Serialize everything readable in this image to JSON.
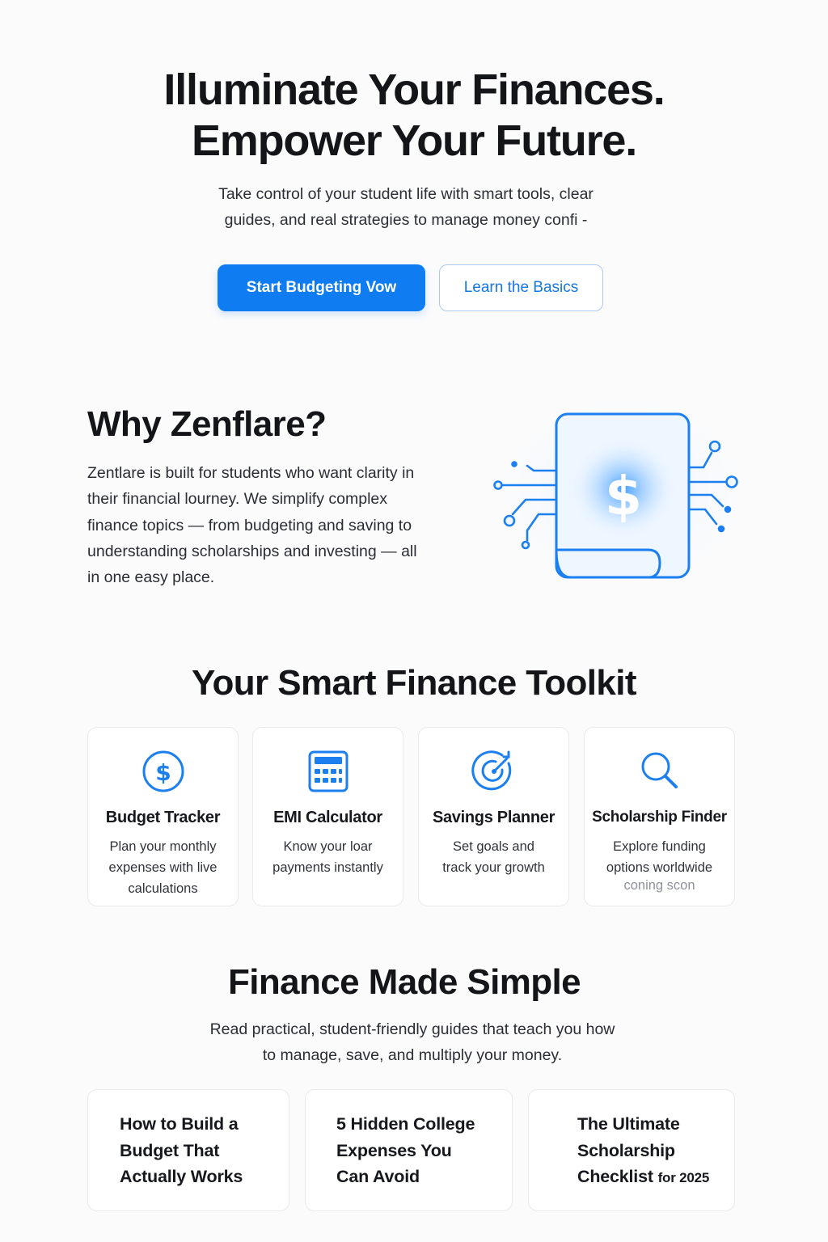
{
  "hero": {
    "title_line1": "Illuminate Your Finances.",
    "title_line2": "Empower Your Future.",
    "subtitle_line1": "Take control of your student life with smart tools, clear",
    "subtitle_line2": "guides, and real strategies to manage money confi -",
    "primary_button": "Start Budgeting Vow",
    "secondary_button": "Learn the Basics"
  },
  "why": {
    "title": "Why Zenflare?",
    "body_lines": [
      "Zentlare is built for students who want clarity in",
      "their financial lourney. We simplify complex",
      "finance topics — from budgeting and saving to",
      "understanding scholarships and investing — all",
      "in one easy place."
    ],
    "illustration_icon": "dollar-document-circuit-icon",
    "illustration_symbol": "$"
  },
  "toolkit": {
    "title": "Your Smart Finance Toolkit",
    "cards": [
      {
        "icon": "dollar-circle-icon",
        "name": "Budget Tracker",
        "desc_lines": [
          "Plan your monthly",
          "expenses with live",
          "calculations"
        ],
        "note": ""
      },
      {
        "icon": "calculator-icon",
        "name": "EMI Calculator",
        "desc_lines": [
          "Know your loar",
          "payments instantly"
        ],
        "note": ""
      },
      {
        "icon": "target-icon",
        "name": "Savings Planner",
        "desc_lines": [
          "Set goals and",
          "track your growth"
        ],
        "note": ""
      },
      {
        "icon": "search-icon",
        "name": "Scholarship Finder",
        "desc_lines": [
          "Explore funding",
          "options worldwide"
        ],
        "note": "coning scon"
      }
    ]
  },
  "simple": {
    "title": "Finance Made Simple",
    "subtitle_line1": "Read practical, student-friendly guides that teach you how",
    "subtitle_line2": "to manage, save, and multiply your money.",
    "guides": [
      {
        "lines": [
          "How to Build a",
          "Budget That",
          "Actually Works"
        ],
        "suffix": ""
      },
      {
        "lines": [
          "5 Hidden College",
          "Expenses You",
          "Can Avoid"
        ],
        "suffix": ""
      },
      {
        "lines": [
          "The Ultimate",
          "Scholarship",
          "Checklist"
        ],
        "suffix": "for 2025"
      }
    ]
  },
  "colors": {
    "accent": "#0f7cf2",
    "text": "#16181d",
    "muted": "#8d9199",
    "card_border": "#e8eaee"
  }
}
